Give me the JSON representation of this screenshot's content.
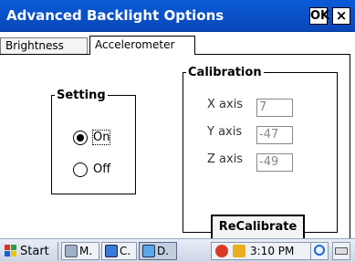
{
  "window": {
    "title": "Advanced Backlight Options",
    "ok_label": "OK",
    "close_label": "×"
  },
  "tabs": [
    {
      "label": "Brightness"
    },
    {
      "label": "Accelerometer",
      "selected": true
    }
  ],
  "setting": {
    "legend": "Setting",
    "options": [
      {
        "label": "On",
        "selected": true
      },
      {
        "label": "Off",
        "selected": false
      }
    ]
  },
  "calibration": {
    "legend": "Calibration",
    "axes": [
      {
        "label": "X axis",
        "value": "7"
      },
      {
        "label": "Y axis",
        "value": "-47"
      },
      {
        "label": "Z axis",
        "value": "-49"
      }
    ],
    "recalibrate_label": "ReCalibrate"
  },
  "taskbar": {
    "start_label": "Start",
    "tasks": [
      {
        "label": "M.",
        "icon": "monitor-icon"
      },
      {
        "label": "C.",
        "icon": "control-panel-icon"
      },
      {
        "label": "D.",
        "icon": "device-icon",
        "active": true
      }
    ],
    "clock": "3:10 PM",
    "tray_icons": [
      "bug-icon",
      "usb-icon"
    ],
    "right_icons": [
      "ie-icon",
      "keyboard-icon"
    ]
  },
  "colors": {
    "titlebar": "#0a50c8",
    "taskbar": "#d6ddea"
  }
}
